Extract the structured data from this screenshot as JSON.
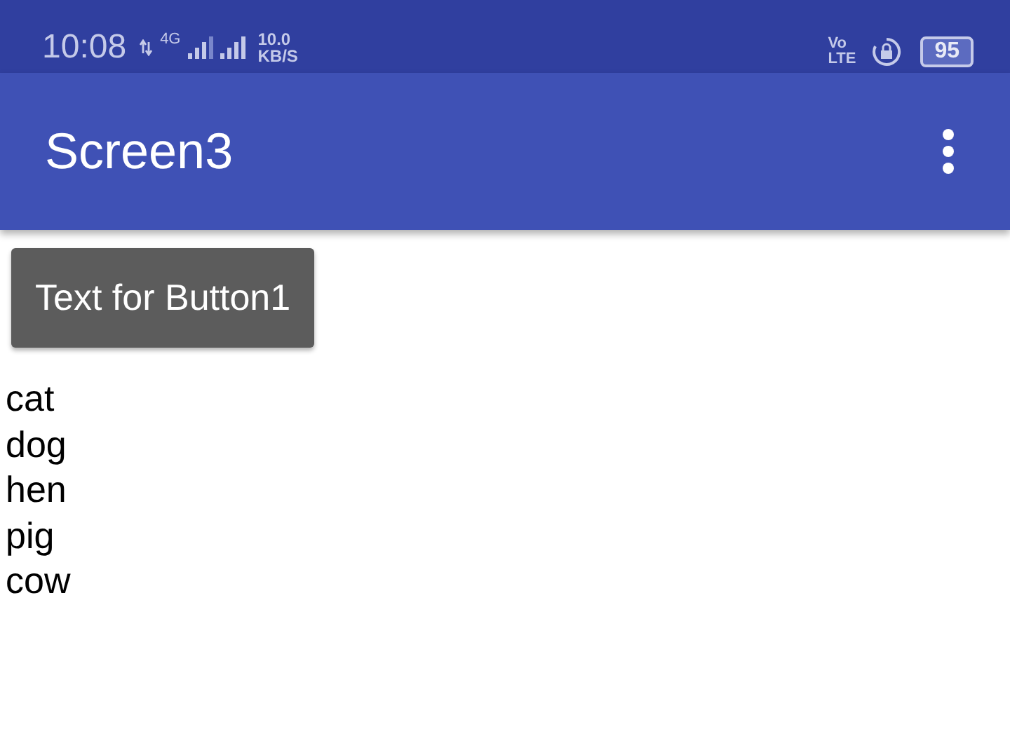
{
  "status_bar": {
    "time": "10:08",
    "network": "4G",
    "speed_value": "10.0",
    "speed_unit": "KB/S",
    "volte_top": "Vo",
    "volte_bottom": "LTE",
    "battery": "95"
  },
  "app_bar": {
    "title": "Screen3"
  },
  "button": {
    "label": "Text for Button1"
  },
  "items": [
    "cat",
    "dog",
    "hen",
    "pig",
    "cow"
  ]
}
